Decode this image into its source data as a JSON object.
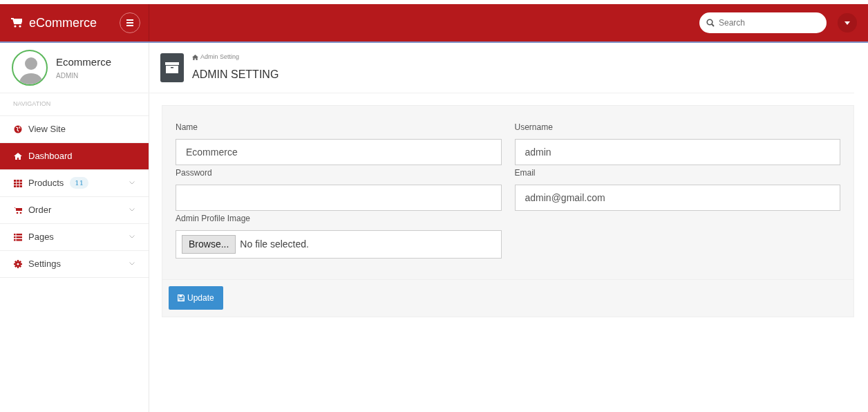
{
  "brand": {
    "title": "eCommerce"
  },
  "search": {
    "placeholder": "Search"
  },
  "profile": {
    "name": "Ecommerce",
    "role": "ADMIN"
  },
  "sidebar": {
    "heading": "NAVIGATION",
    "items": [
      {
        "label": "View Site",
        "selected": false,
        "expandable": false
      },
      {
        "label": "Dashboard",
        "selected": true,
        "expandable": false
      },
      {
        "label": "Products",
        "badge": "11",
        "selected": false,
        "expandable": true
      },
      {
        "label": "Order",
        "selected": false,
        "expandable": true
      },
      {
        "label": "Pages",
        "selected": false,
        "expandable": true
      },
      {
        "label": "Settings",
        "selected": false,
        "expandable": true
      }
    ]
  },
  "page": {
    "breadcrumb": "Admin Setting",
    "title": "ADMIN SETTING"
  },
  "form": {
    "fields": [
      {
        "kind": "text",
        "label": "Name",
        "value": "Ecommerce"
      },
      {
        "kind": "text",
        "label": "Username",
        "value": "admin"
      },
      {
        "kind": "password",
        "label": "Password"
      },
      {
        "kind": "text",
        "label": "Email",
        "value": "admin@gmail.com"
      },
      {
        "kind": "file",
        "label": "Admin Profile Image",
        "button": "Browse...",
        "status": "No file selected."
      }
    ],
    "submit": "Update"
  }
}
